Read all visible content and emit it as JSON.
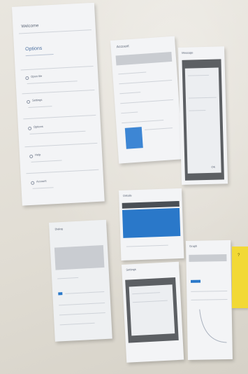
{
  "sheet1": {
    "title": "Welcome",
    "section": "Options",
    "items": [
      "Open file",
      "Settings",
      "Options",
      "Help",
      "Account"
    ]
  },
  "sheet2": {
    "title": "Account"
  },
  "sheet3": {
    "title": "Message",
    "button": "OK"
  },
  "sheet4": {
    "title": "Dialog"
  },
  "sheet5": {
    "title": "Details"
  },
  "sheet6": {
    "title": "Settings"
  },
  "sheet7": {
    "title": "Graph"
  },
  "postit": {
    "note": "?"
  }
}
